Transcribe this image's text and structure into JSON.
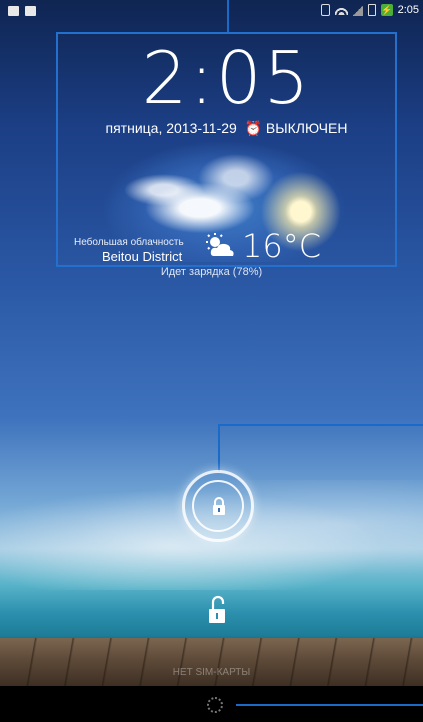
{
  "status_bar": {
    "time": "2:05",
    "left_icons": [
      "sd-card-icon",
      "image-icon"
    ],
    "right_icons": [
      "vibrate-icon",
      "wifi-icon",
      "signal-icon",
      "battery-icon",
      "charging-icon"
    ]
  },
  "clock_widget": {
    "time": "2:05",
    "date": "пятница, 2013-11-29",
    "alarm_status": "ВЫКЛЮЧЕН",
    "weather_condition": "Небольшая облачность",
    "city": "Beitou District",
    "temperature": "16°C"
  },
  "charging_text": "Идет зарядка (78%)",
  "bottom_text": "НЕТ SIM-КАРТЫ",
  "colors": {
    "callout_line": "#1a6bc8",
    "widget_border": "#2470cf"
  }
}
